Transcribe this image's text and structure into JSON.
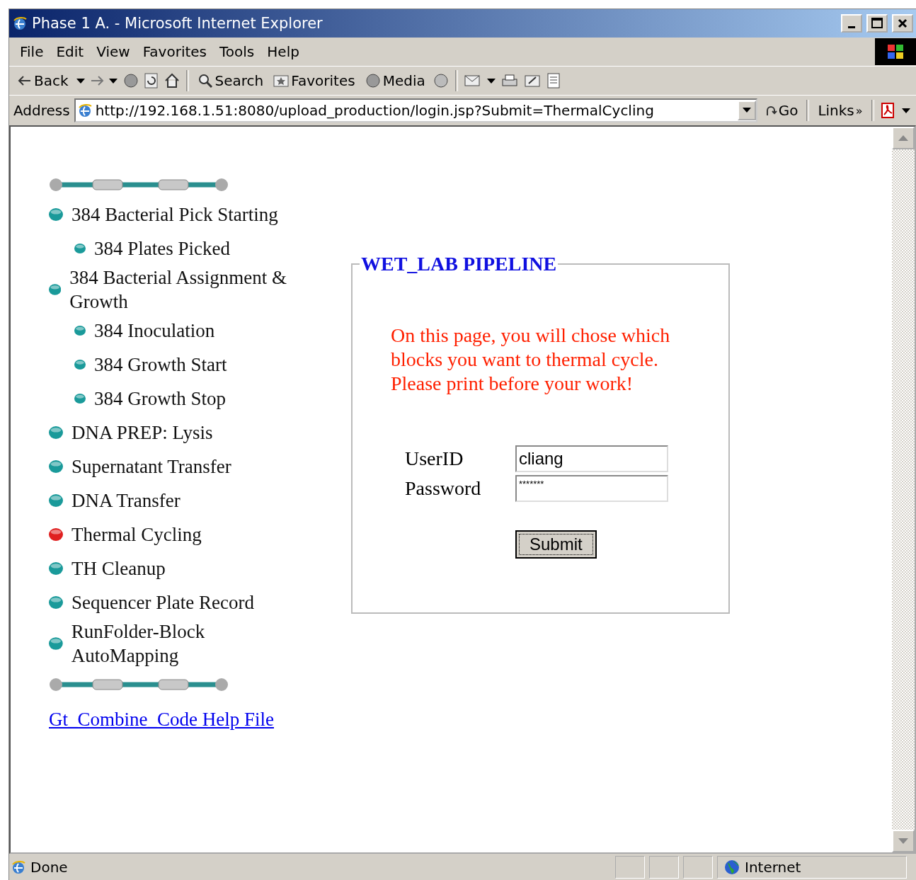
{
  "window": {
    "title": "Phase 1 A. - Microsoft Internet Explorer"
  },
  "menu": [
    "File",
    "Edit",
    "View",
    "Favorites",
    "Tools",
    "Help"
  ],
  "toolbar": {
    "back": "Back",
    "search": "Search",
    "favorites": "Favorites",
    "media": "Media"
  },
  "address": {
    "label": "Address",
    "url": "http://192.168.1.51:8080/upload_production/login.jsp?Submit=ThermalCycling",
    "go": "Go",
    "links": "Links",
    "more": "»"
  },
  "nav": {
    "items": [
      {
        "kind": "main",
        "label": "384 Bacterial Pick Starting",
        "selected": false
      },
      {
        "kind": "sub",
        "label": "384 Plates Picked",
        "selected": false
      },
      {
        "kind": "main",
        "label": "384 Bacterial Assignment & Growth",
        "selected": false
      },
      {
        "kind": "sub",
        "label": "384 Inoculation",
        "selected": false
      },
      {
        "kind": "sub",
        "label": "384 Growth Start",
        "selected": false
      },
      {
        "kind": "sub",
        "label": "384 Growth Stop",
        "selected": false
      },
      {
        "kind": "main",
        "label": "DNA PREP: Lysis",
        "selected": false
      },
      {
        "kind": "main",
        "label": "Supernatant Transfer",
        "selected": false
      },
      {
        "kind": "main",
        "label": "DNA Transfer",
        "selected": false
      },
      {
        "kind": "main",
        "label": "Thermal Cycling",
        "selected": true
      },
      {
        "kind": "main",
        "label": "TH Cleanup",
        "selected": false
      },
      {
        "kind": "main",
        "label": "Sequencer Plate Record",
        "selected": false
      },
      {
        "kind": "main",
        "label": "RunFolder-Block AutoMapping",
        "selected": false
      }
    ],
    "help_link": "Gt_Combine_Code Help File"
  },
  "form": {
    "legend": "WET_LAB PIPELINE",
    "message": "On this page, you will chose which blocks you want to thermal cycle. Please print before your work!",
    "fields": [
      {
        "label": "UserID",
        "value": "cliang"
      },
      {
        "label": "Password",
        "value": "*******"
      }
    ],
    "submit": "Submit"
  },
  "status": {
    "text": "Done",
    "zone": "Internet"
  }
}
